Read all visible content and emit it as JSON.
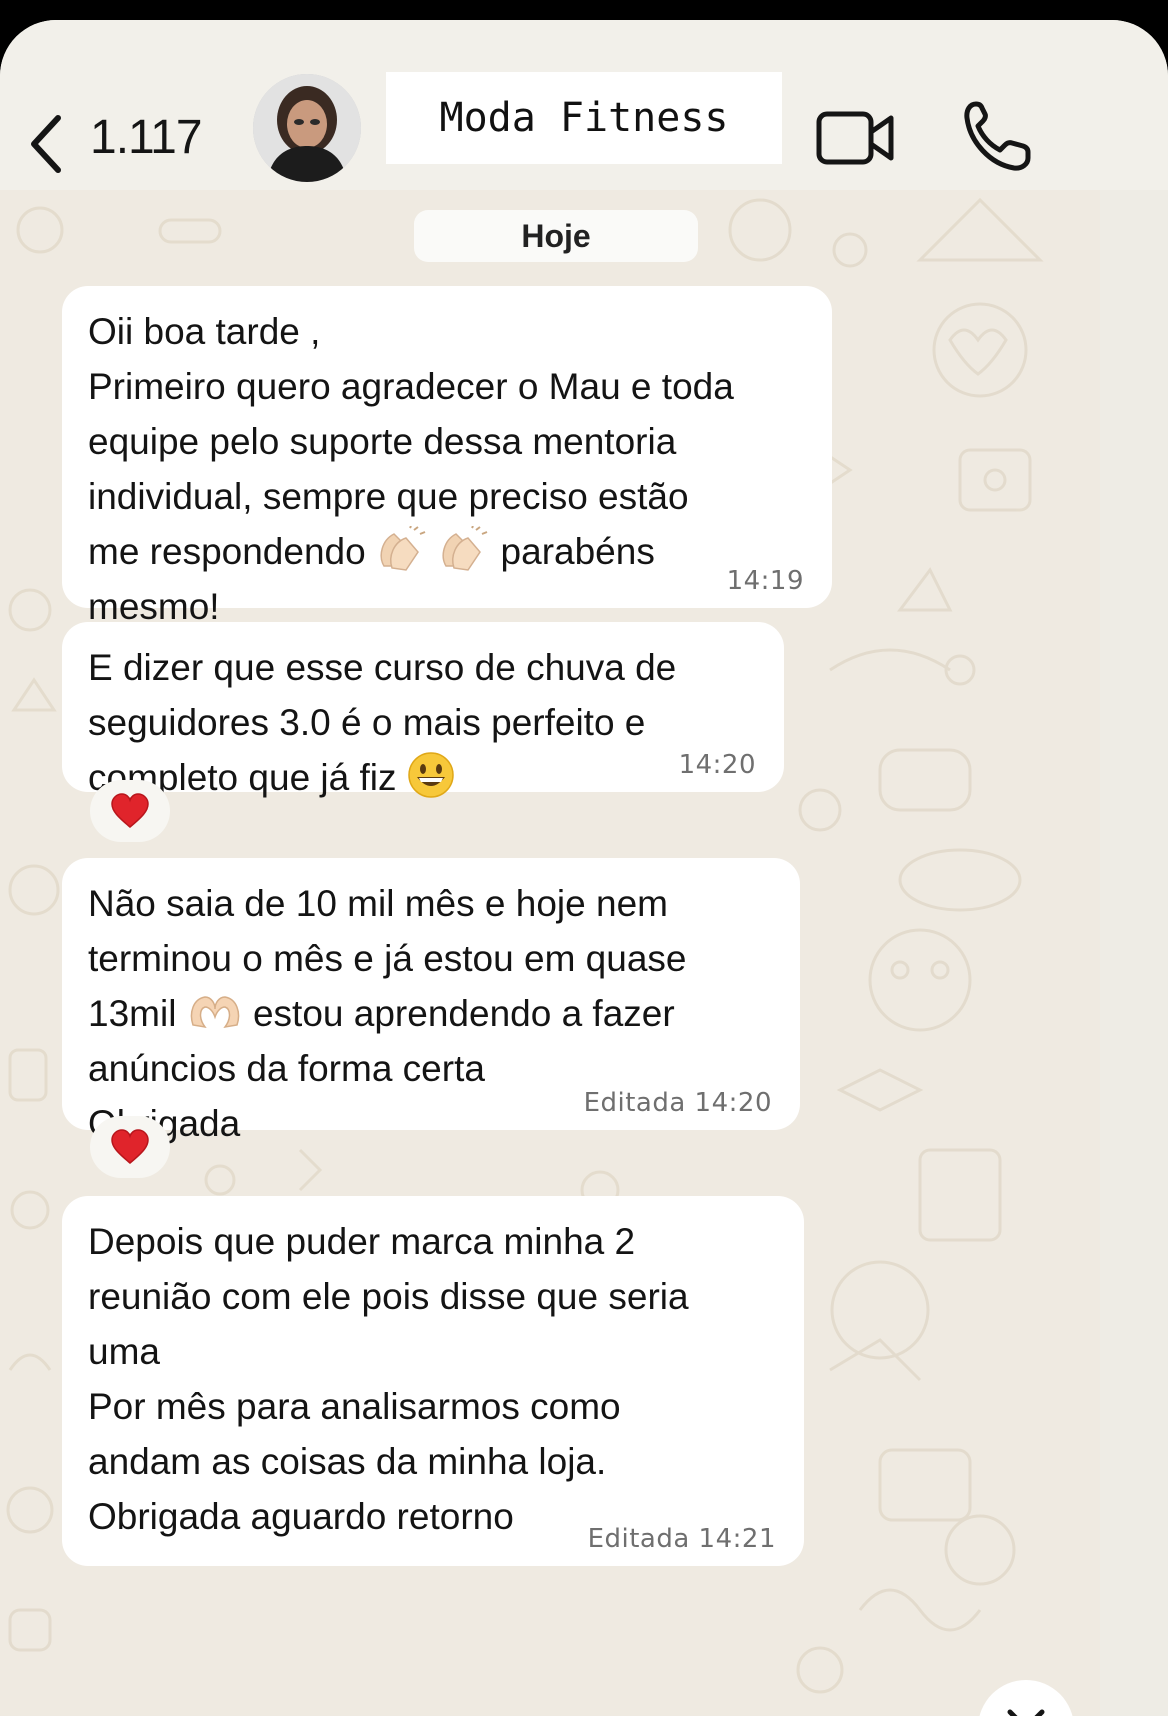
{
  "header": {
    "back_count": "1.117",
    "title": "Moda Fitness"
  },
  "chat": {
    "date_label": "Hoje",
    "messages": [
      {
        "lines": [
          "Oii boa tarde ,",
          "Primeiro quero agradecer o Mau e toda",
          "equipe pelo suporte dessa mentoria",
          "individual, sempre que preciso estão",
          "me respondendo",
          "parabéns",
          "mesmo!"
        ],
        "emoji": [
          "clapping-hands",
          "clapping-hands"
        ],
        "time": "14:19"
      },
      {
        "lines": [
          "E dizer que esse curso de chuva de",
          "seguidores 3.0 é o mais perfeito  e",
          "completo que já fiz"
        ],
        "emoji": [
          "grinning-face"
        ],
        "time": "14:20",
        "reaction": "❤️"
      },
      {
        "lines": [
          "Não saia de 10 mil mês e hoje nem",
          "terminou o mês e já estou em quase",
          "13mil",
          "estou aprendendo a fazer",
          "anúncios da forma certa",
          "Obrigada"
        ],
        "emoji": [
          "heart-hands"
        ],
        "time": "Editada 14:20",
        "reaction": "❤️"
      },
      {
        "lines": [
          "Depois que puder marca minha 2",
          "reunião com ele pois disse que seria",
          "uma",
          "Por mês para analisarmos como",
          "andam as coisas da minha loja.",
          "Obrigada aguardo retorno"
        ],
        "time": "Editada 14:21"
      }
    ]
  },
  "icons": {
    "back": "chevron-left-icon",
    "video": "video-camera-icon",
    "call": "phone-icon",
    "scroll": "chevron-down-icon"
  }
}
